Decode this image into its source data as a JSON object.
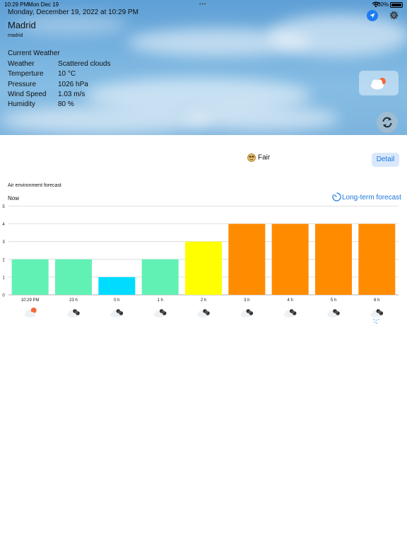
{
  "status_bar": {
    "time": "10:29 PM",
    "date": "Mon Dec 19",
    "battery": "100%"
  },
  "header": {
    "datetime": "Monday, December 19, 2022 at 10:29 PM",
    "city": "Madrid",
    "city_sub": "madrid",
    "current_title": "Current Weather",
    "rows": [
      {
        "label": "Weather",
        "value": "Scattered clouds"
      },
      {
        "label": "Temperture",
        "value": "10 °C"
      },
      {
        "label": "Pressure",
        "value": "1026 hPa"
      },
      {
        "label": "Wind Speed",
        "value": "1.03 m/s"
      },
      {
        "label": "Humidity",
        "value": "80 %"
      }
    ]
  },
  "air": {
    "status": "Fair",
    "detail_label": "Detail"
  },
  "forecast": {
    "title": "Air environment forecast",
    "now_label": "Now",
    "long_term_label": "Long-term forecast"
  },
  "chart_data": {
    "type": "bar",
    "categories": [
      "10:29 PM",
      "23 h",
      "0 h",
      "1 h",
      "2 h",
      "3 h",
      "4 h",
      "5 h",
      "6 h"
    ],
    "values": [
      2,
      2,
      1,
      2,
      3,
      4,
      4,
      4,
      4
    ],
    "ylim": [
      0,
      5
    ],
    "yticks": [
      0,
      1,
      2,
      3,
      4,
      5
    ],
    "colors": [
      "#61f1b5",
      "#61f1b5",
      "#00dcff",
      "#61f1b5",
      "#ffff00",
      "#ff8c00",
      "#ff8c00",
      "#ff8c00",
      "#ff8c00"
    ],
    "grid": true,
    "weather_icons": [
      "partly-cloudy-night-icon",
      "cloudy-icon",
      "cloudy-icon",
      "cloudy-icon",
      "cloudy-icon",
      "cloudy-icon",
      "cloudy-icon",
      "cloudy-icon",
      "cloudy-rain-icon"
    ]
  }
}
